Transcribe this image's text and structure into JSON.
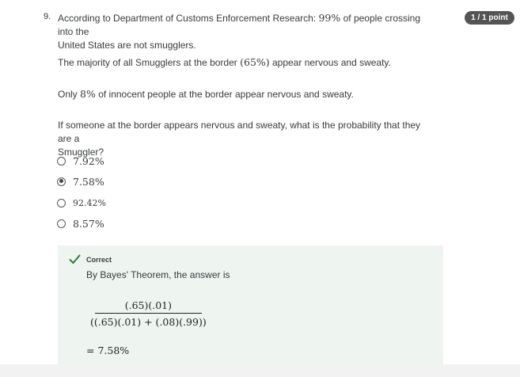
{
  "question": {
    "number": "9.",
    "score_badge": "1 / 1 point",
    "intro_a": "According to Department of Customs Enforcement Research: ",
    "intro_pct": "99%",
    "intro_b": " of people crossing into the",
    "intro_line2": "United States are not smugglers.",
    "p2_a": "The majority of all Smugglers at the border ",
    "p2_pct": "(65%)",
    "p2_b": " appear nervous and sweaty.",
    "p3_a": "Only ",
    "p3_pct": "8%",
    "p3_b": " of innocent people at the border appear nervous and sweaty.",
    "prompt_line1": "If someone at the border appears nervous and sweaty, what is the probability that they are a",
    "prompt_line2": "Smuggler?"
  },
  "options": [
    {
      "label": "7.92%",
      "selected": false
    },
    {
      "label": "7.58%",
      "selected": true
    },
    {
      "label": "92.42%",
      "selected": false
    },
    {
      "label": "8.57%",
      "selected": false
    }
  ],
  "feedback": {
    "status": "Correct",
    "explanation": "By Bayes' Theorem, the answer is",
    "numerator": "(.65)(.01)",
    "denominator": "((.65)(.01) + (.08)(.99))",
    "result": "= 7.58%",
    "icon": "checkmark-icon",
    "accent_color": "#2e7d32",
    "background_color": "#eef5f1"
  },
  "badge_color": "#545454"
}
